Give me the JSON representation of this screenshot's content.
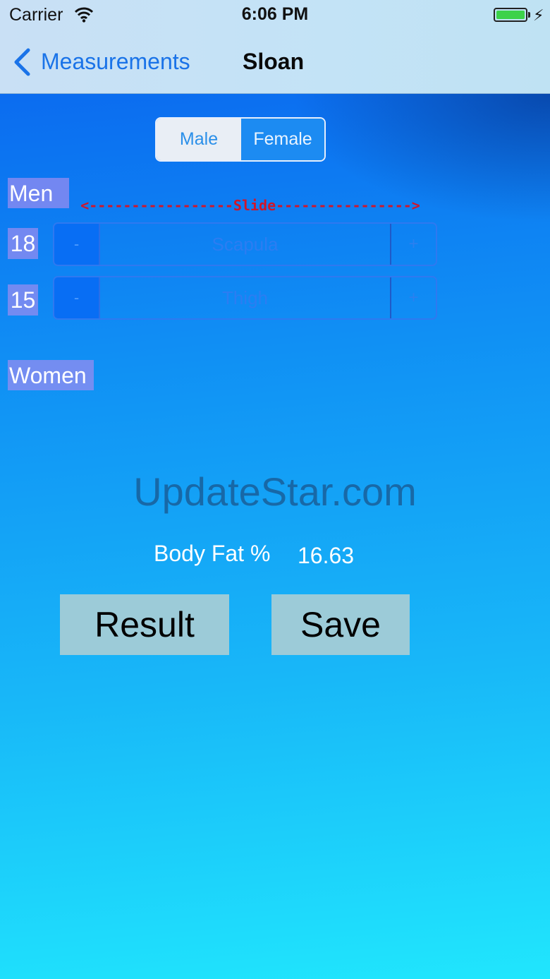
{
  "status_bar": {
    "carrier": "Carrier",
    "time": "6:06 PM",
    "wifi_icon": "wifi-icon",
    "battery_icon": "battery-icon",
    "charge_icon": "charging-bolt-icon"
  },
  "nav": {
    "back_label": "Measurements",
    "title": "Sloan",
    "back_icon": "chevron-left-icon"
  },
  "gender_segment": {
    "options": [
      "Male",
      "Female"
    ],
    "selected": "Female"
  },
  "men_section": {
    "label": "Men",
    "slide_hint": "<-----------------Slide---------------->",
    "rows": [
      {
        "value": "18",
        "minus": "-",
        "name": "Scapula",
        "plus": "+"
      },
      {
        "value": "15",
        "minus": "-",
        "name": "Thigh",
        "plus": "+"
      }
    ]
  },
  "women_section": {
    "label": "Women"
  },
  "watermark": "UpdateStar.com",
  "result": {
    "label": "Body Fat %",
    "value": "16.63"
  },
  "buttons": {
    "result": "Result",
    "save": "Save"
  },
  "colors": {
    "accent": "#1a73e8",
    "segment_selected": "#1c8bf2",
    "button_bg": "#9ccbd8",
    "label_bg": "#968cf0",
    "slide_hint": "#d0162a"
  }
}
